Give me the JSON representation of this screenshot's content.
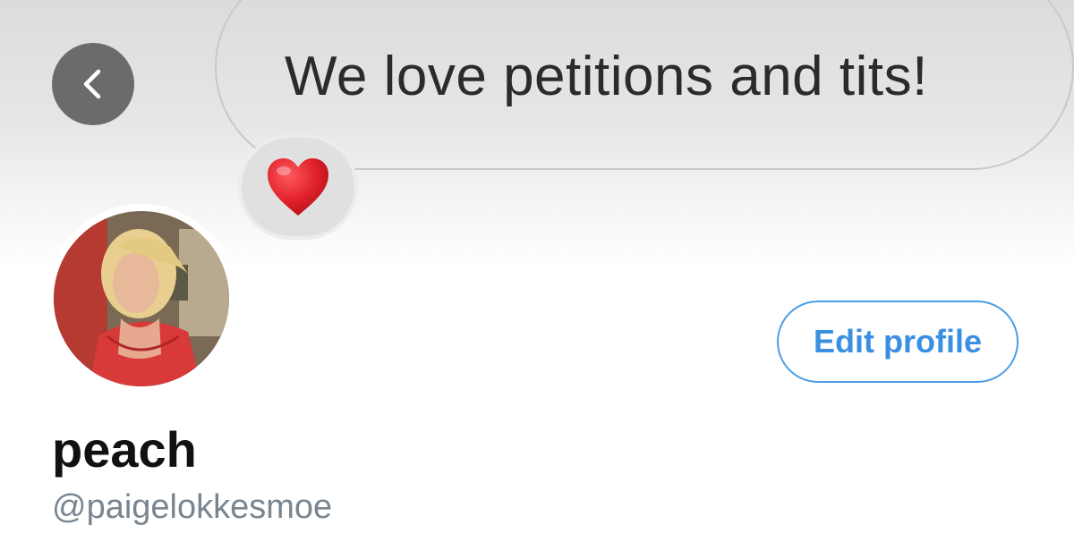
{
  "message": {
    "text": "We love petitions and tits!",
    "reaction_icon": "heart-icon",
    "reaction_color": "#e0202a"
  },
  "navigation": {
    "back_icon": "chevron-left-icon"
  },
  "profile": {
    "display_name": "peach",
    "handle": "@paigelokkesmoe",
    "edit_button_label": "Edit profile",
    "avatar_icon": "profile-photo"
  },
  "colors": {
    "accent": "#3b8fe0",
    "back_button_bg": "#6b6b6b",
    "handle_text": "#7a8590"
  }
}
